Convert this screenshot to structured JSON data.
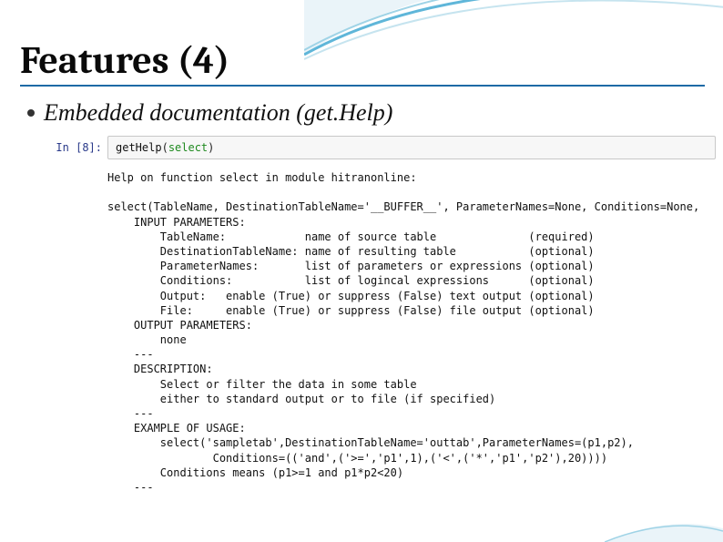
{
  "title": "Features (4)",
  "bullet": "Embedded documentation (get.Help)",
  "prompt": "In [8]:",
  "code": {
    "fn": "getHelp",
    "arg": "select"
  },
  "output_lines": [
    "Help on function select in module hitranonline:",
    "",
    "select(TableName, DestinationTableName='__BUFFER__', ParameterNames=None, Conditions=None,",
    "    INPUT PARAMETERS:",
    "        TableName:            name of source table              (required)",
    "        DestinationTableName: name of resulting table           (optional)",
    "        ParameterNames:       list of parameters or expressions (optional)",
    "        Conditions:           list of logincal expressions      (optional)",
    "        Output:   enable (True) or suppress (False) text output (optional)",
    "        File:     enable (True) or suppress (False) file output (optional)",
    "    OUTPUT PARAMETERS:",
    "        none",
    "    ---",
    "    DESCRIPTION:",
    "        Select or filter the data in some table",
    "        either to standard output or to file (if specified)",
    "    ---",
    "    EXAMPLE OF USAGE:",
    "        select('sampletab',DestinationTableName='outtab',ParameterNames=(p1,p2),",
    "                Conditions=(('and',('>=','p1',1),('<',('*','p1','p2'),20))))",
    "        Conditions means (p1>=1 and p1*p2<20)",
    "    ---"
  ]
}
